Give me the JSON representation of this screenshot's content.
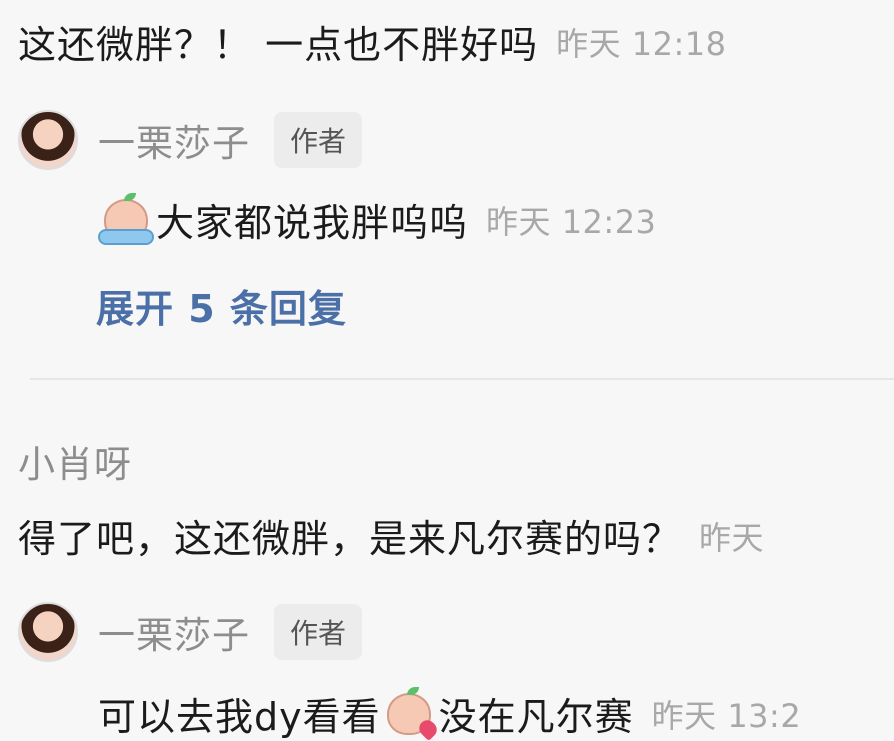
{
  "thread": {
    "top_reply": {
      "text": "这还微胖？！  一点也不胖好吗",
      "time": "昨天 12:18"
    },
    "author_reply_1": {
      "author": "一栗莎子",
      "badge": "作者",
      "emoji": "crying-emoji",
      "text": "大家都说我胖呜呜",
      "time": "昨天 12:23"
    },
    "expand_link": "展开 5 条回复",
    "comment": {
      "user": "小肖呀",
      "text": "得了吧，这还微胖，是来凡尔赛的吗？",
      "time": "昨天"
    },
    "author_reply_2": {
      "author": "一栗莎子",
      "badge": "作者",
      "text_before": "可以去我dy看看",
      "emoji": "kiss-heart-emoji",
      "text_after": "没在凡尔赛",
      "time": "昨天 13:2"
    }
  }
}
